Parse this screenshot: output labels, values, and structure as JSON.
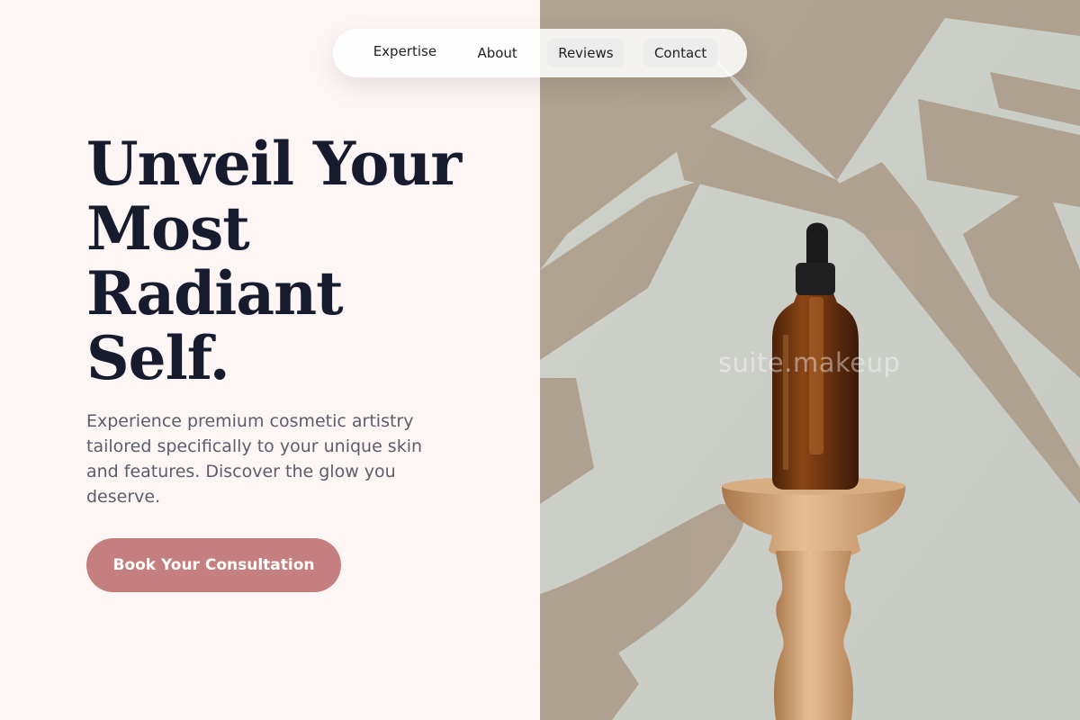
{
  "nav": {
    "items": [
      {
        "label": "Expertise"
      },
      {
        "label": "About"
      },
      {
        "label": "Reviews"
      },
      {
        "label": "Contact"
      }
    ]
  },
  "hero": {
    "title": "Unveil Your Most Radiant Self.",
    "subtitle": "Experience premium cosmetic artistry tailored specifically to your unique skin and features. Discover the glow you deserve.",
    "cta_label": "Book Your Consultation"
  },
  "watermark": "suite.makeup",
  "colors": {
    "background": "#fdf6f5",
    "heading": "#161b2e",
    "body_text": "#5b5d6b",
    "accent": "#c47f7e"
  }
}
